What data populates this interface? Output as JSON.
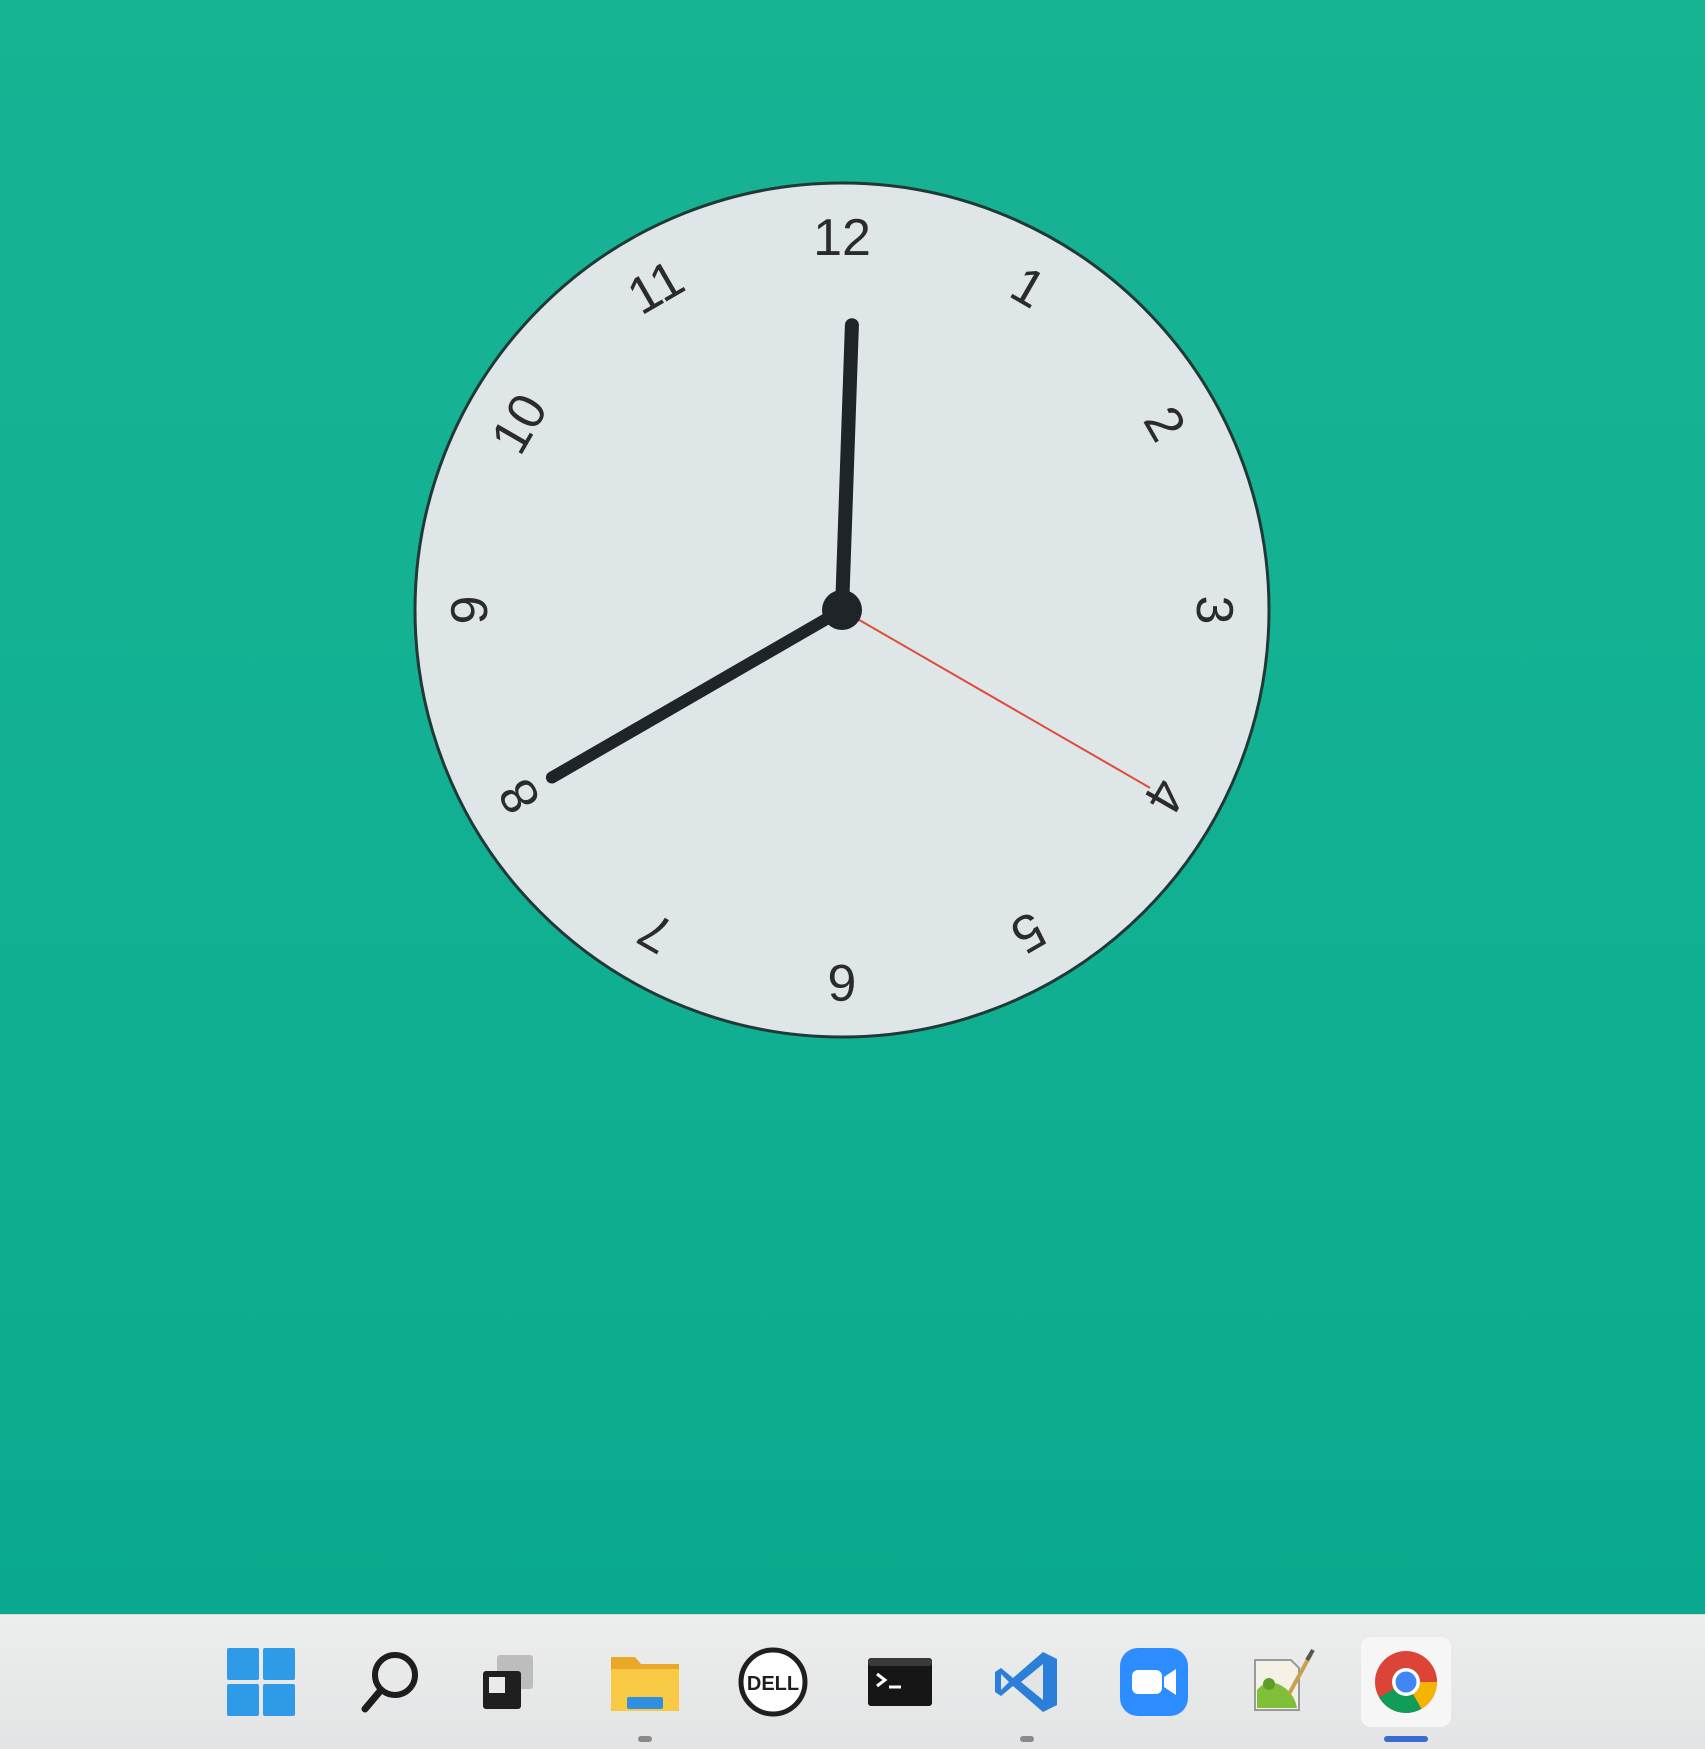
{
  "clock": {
    "numbers": [
      "12",
      "1",
      "2",
      "3",
      "4",
      "5",
      "6",
      "7",
      "8",
      "9",
      "10",
      "11"
    ],
    "time": {
      "hour": 8,
      "minute": 0,
      "second": 20
    },
    "colors": {
      "face": "#dfe6e7",
      "rim": "#1f3a34",
      "hands": "#1e2428",
      "second_hand": "#e04a3c"
    }
  },
  "desktop": {
    "background_color": "#12b093"
  },
  "taskbar": {
    "items": [
      {
        "id": "start",
        "icon": "windows-logo-icon"
      },
      {
        "id": "search",
        "icon": "search-icon"
      },
      {
        "id": "task-view",
        "icon": "task-view-icon"
      },
      {
        "id": "file-explorer",
        "icon": "folder-icon",
        "running": true
      },
      {
        "id": "dell",
        "icon": "dell-logo-icon",
        "label": "DELL"
      },
      {
        "id": "terminal",
        "icon": "terminal-icon"
      },
      {
        "id": "vscode",
        "icon": "vscode-icon",
        "running": true
      },
      {
        "id": "zoom",
        "icon": "zoom-icon"
      },
      {
        "id": "notepad-pp",
        "icon": "notepad-plus-plus-icon"
      },
      {
        "id": "chrome",
        "icon": "chrome-icon",
        "active": true
      }
    ]
  }
}
